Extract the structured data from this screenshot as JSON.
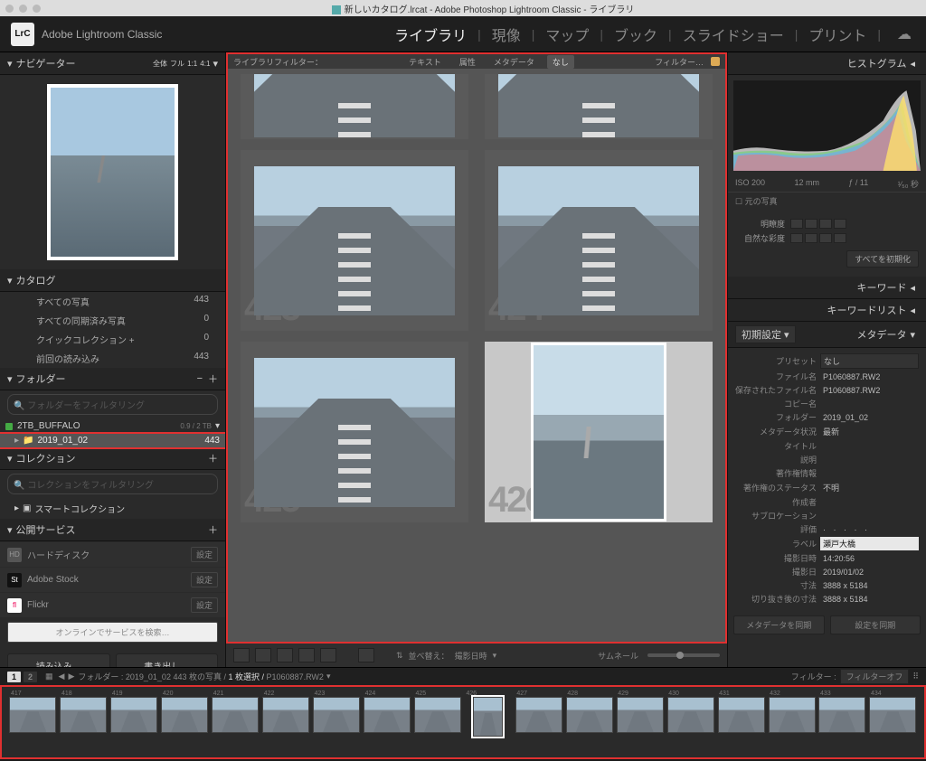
{
  "window": {
    "title": "新しいカタログ.lrcat - Adobe Photoshop Lightroom Classic - ライブラリ"
  },
  "app": {
    "badge": "LrC",
    "name": "Adobe Lightroom Classic"
  },
  "modules": {
    "library": "ライブラリ",
    "develop": "現像",
    "map": "マップ",
    "book": "ブック",
    "slideshow": "スライドショー",
    "print": "プリント"
  },
  "nav": {
    "title": "ナビゲーター",
    "fit": "全体",
    "fill": "フル",
    "r1": "1:1",
    "r2": "4:1"
  },
  "catalog": {
    "title": "カタログ",
    "rows": [
      {
        "label": "すべての写真",
        "count": "443"
      },
      {
        "label": "すべての同期済み写真",
        "count": "0"
      },
      {
        "label": "クイックコレクション +",
        "count": "0"
      },
      {
        "label": "前回の読み込み",
        "count": "443"
      }
    ]
  },
  "folders": {
    "title": "フォルダー",
    "filter_placeholder": "フォルダーをフィルタリング",
    "volume": "2TB_BUFFALO",
    "volume_usage": "0.9 / 2 TB",
    "folder_name": "2019_01_02",
    "folder_count": "443"
  },
  "collections": {
    "title": "コレクション",
    "filter_placeholder": "コレクションをフィルタリング",
    "smart": "スマートコレクション"
  },
  "publish": {
    "title": "公開サービス",
    "items": [
      {
        "icon": "HD",
        "name": "ハードディスク",
        "btn": "設定"
      },
      {
        "icon": "St",
        "name": "Adobe Stock",
        "btn": "設定"
      },
      {
        "icon": "fl",
        "name": "Flickr",
        "btn": "設定"
      }
    ],
    "find": "オンラインでサービスを検索…"
  },
  "left_buttons": {
    "import": "読み込み…",
    "export": "書き出し…"
  },
  "filterbar": {
    "label": "ライブラリフィルター：",
    "tabs": {
      "text": "テキスト",
      "attr": "属性",
      "meta": "メタデータ",
      "none": "なし"
    },
    "menu": "フィルター…"
  },
  "grid": {
    "cells": [
      {
        "idx": "",
        "sel": false,
        "orient": "crop"
      },
      {
        "idx": "",
        "sel": false,
        "orient": "crop"
      },
      {
        "idx": "423",
        "sel": false,
        "orient": "land"
      },
      {
        "idx": "424",
        "sel": false,
        "orient": "land"
      },
      {
        "idx": "425",
        "sel": false,
        "orient": "land"
      },
      {
        "idx": "426",
        "sel": true,
        "orient": "port"
      }
    ]
  },
  "toolbar": {
    "sort_label": "並べ替え：",
    "sort_value": "撮影日時",
    "thumb_label": "サムネール"
  },
  "right": {
    "histogram_title": "ヒストグラム",
    "iso": "ISO 200",
    "focal": "12 mm",
    "aperture": "ƒ / 11",
    "shutter": "¹⁄₅₀ 秒",
    "original": "元の写真",
    "quickdev": {
      "tone": "明瞭度",
      "vibrance": "自然な彩度",
      "reset": "すべてを初期化"
    },
    "keyword_title": "キーワード",
    "keywordlist_title": "キーワードリスト",
    "metadata_title": "メタデータ",
    "metadata_set": "初期設定",
    "preset_label": "プリセット",
    "preset_value": "なし",
    "rows": [
      {
        "lab": "ファイル名",
        "val": "P1060887.RW2"
      },
      {
        "lab": "保存されたファイル名",
        "val": "P1060887.RW2"
      },
      {
        "lab": "コピー名",
        "val": ""
      },
      {
        "lab": "フォルダー",
        "val": "2019_01_02"
      },
      {
        "lab": "メタデータ状況",
        "val": "最新"
      },
      {
        "lab": "タイトル",
        "val": ""
      },
      {
        "lab": "説明",
        "val": ""
      },
      {
        "lab": "著作権情報",
        "val": ""
      },
      {
        "lab": "著作権のステータス",
        "val": "不明"
      },
      {
        "lab": "作成者",
        "val": ""
      },
      {
        "lab": "サブロケーション",
        "val": ""
      }
    ],
    "rating_label": "評価",
    "label_label": "ラベル",
    "label_value": "瀬戸大橋",
    "datetime_label": "撮影日時",
    "datetime_value": "14:20:56",
    "date_label": "撮影日",
    "date_value": "2019/01/02",
    "dims_label": "寸法",
    "dims_value": "3888 x 5184",
    "crop_label": "切り抜き後の寸法",
    "crop_value": "3888 x 5184",
    "sync_meta": "メタデータを同期",
    "sync_set": "設定を同期"
  },
  "secondbar": {
    "path": "フォルダー : 2019_01_02",
    "count": "443 枚の写真 /",
    "selected": "1 枚選択 /",
    "file": "P1060887.RW2",
    "filter_label": "フィルター :",
    "filter_value": "フィルターオフ"
  },
  "filmstrip": {
    "start_idx": 417,
    "items": [
      {
        "idx": "417",
        "o": "l"
      },
      {
        "idx": "418",
        "o": "l"
      },
      {
        "idx": "419",
        "o": "l"
      },
      {
        "idx": "420",
        "o": "l"
      },
      {
        "idx": "421",
        "o": "l"
      },
      {
        "idx": "422",
        "o": "l"
      },
      {
        "idx": "423",
        "o": "l"
      },
      {
        "idx": "424",
        "o": "l"
      },
      {
        "idx": "425",
        "o": "l"
      },
      {
        "idx": "426",
        "o": "p",
        "sel": true
      },
      {
        "idx": "427",
        "o": "l"
      },
      {
        "idx": "428",
        "o": "l"
      },
      {
        "idx": "429",
        "o": "l"
      },
      {
        "idx": "430",
        "o": "l"
      },
      {
        "idx": "431",
        "o": "l"
      },
      {
        "idx": "432",
        "o": "l"
      },
      {
        "idx": "433",
        "o": "l"
      },
      {
        "idx": "434",
        "o": "l"
      }
    ]
  }
}
